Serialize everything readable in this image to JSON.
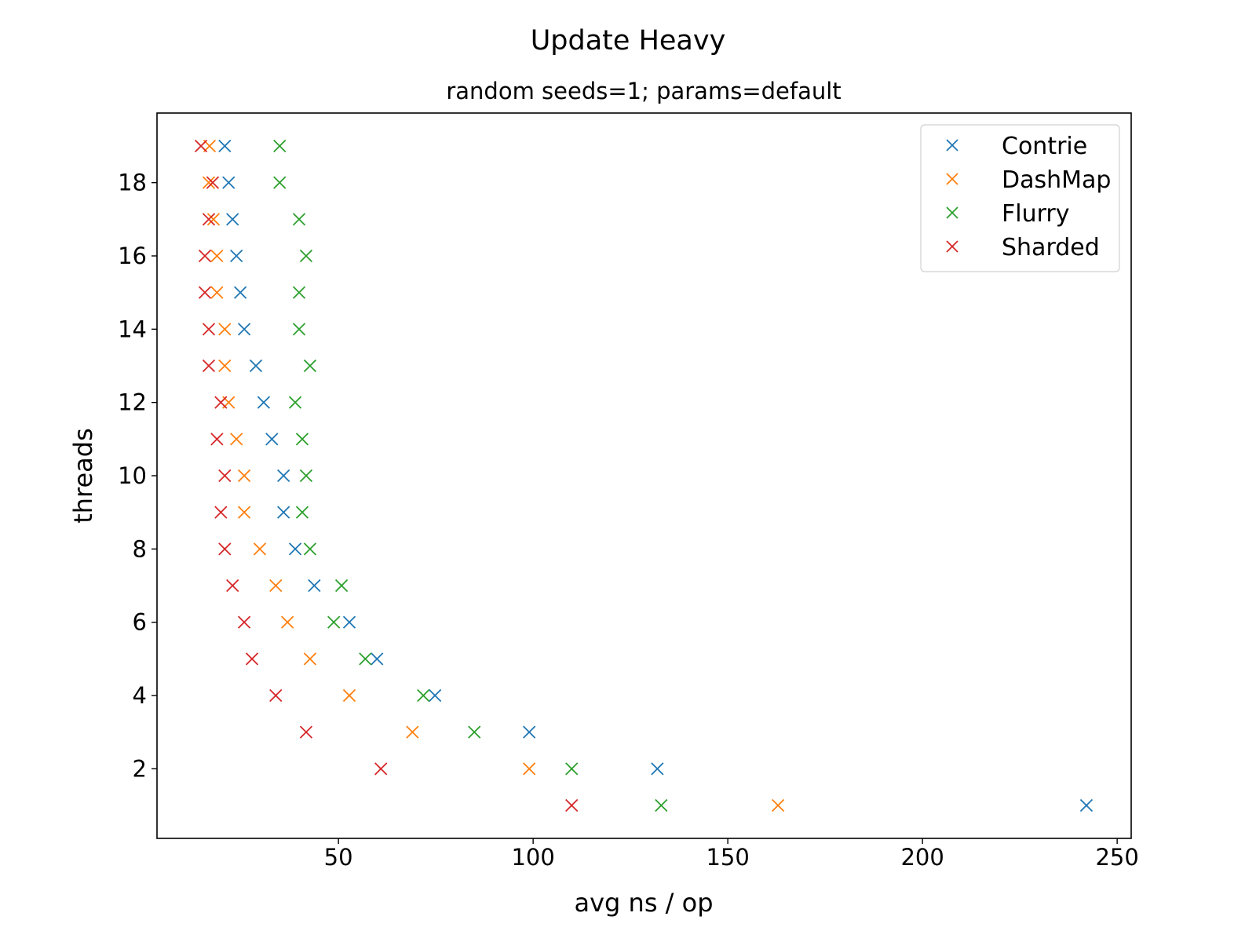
{
  "chart_data": {
    "type": "scatter",
    "title": "Update Heavy",
    "subtitle": "random seeds=1; params=default",
    "xlabel": "avg ns / op",
    "ylabel": "threads",
    "xlim": [
      3.4,
      253.6
    ],
    "ylim": [
      0.1,
      19.9
    ],
    "xticks": [
      50,
      100,
      150,
      200,
      250
    ],
    "yticks": [
      2,
      4,
      6,
      8,
      10,
      12,
      14,
      16,
      18
    ],
    "grid": false,
    "legend_position": "top-right",
    "marker": "x",
    "series": [
      {
        "name": "Contrie",
        "color": "#1f77b4",
        "points": [
          [
            242.1,
            1
          ],
          [
            131.9,
            2
          ],
          [
            99.0,
            3
          ],
          [
            74.8,
            4
          ],
          [
            59.9,
            5
          ],
          [
            52.8,
            6
          ],
          [
            43.8,
            7
          ],
          [
            38.9,
            8
          ],
          [
            35.9,
            9
          ],
          [
            35.9,
            10
          ],
          [
            32.9,
            11
          ],
          [
            30.8,
            12
          ],
          [
            28.8,
            13
          ],
          [
            25.8,
            14
          ],
          [
            24.8,
            15
          ],
          [
            23.8,
            16
          ],
          [
            22.8,
            17
          ],
          [
            21.8,
            18
          ],
          [
            20.8,
            19
          ]
        ]
      },
      {
        "name": "DashMap",
        "color": "#ff7f0e",
        "points": [
          [
            162.9,
            1
          ],
          [
            99.0,
            2
          ],
          [
            69.0,
            3
          ],
          [
            52.8,
            4
          ],
          [
            42.7,
            5
          ],
          [
            36.9,
            6
          ],
          [
            33.9,
            7
          ],
          [
            29.8,
            8
          ],
          [
            25.8,
            9
          ],
          [
            25.8,
            10
          ],
          [
            23.8,
            11
          ],
          [
            21.8,
            12
          ],
          [
            20.8,
            13
          ],
          [
            20.8,
            14
          ],
          [
            18.8,
            15
          ],
          [
            18.8,
            16
          ],
          [
            17.9,
            17
          ],
          [
            16.7,
            18
          ],
          [
            16.9,
            19
          ]
        ]
      },
      {
        "name": "Flurry",
        "color": "#2ca02c",
        "points": [
          [
            132.9,
            1
          ],
          [
            109.9,
            2
          ],
          [
            84.9,
            3
          ],
          [
            71.8,
            4
          ],
          [
            56.9,
            5
          ],
          [
            48.8,
            6
          ],
          [
            50.8,
            7
          ],
          [
            42.7,
            8
          ],
          [
            40.7,
            9
          ],
          [
            41.7,
            10
          ],
          [
            40.7,
            11
          ],
          [
            38.9,
            12
          ],
          [
            42.7,
            13
          ],
          [
            39.9,
            14
          ],
          [
            39.9,
            15
          ],
          [
            41.7,
            16
          ],
          [
            39.9,
            17
          ],
          [
            34.9,
            18
          ],
          [
            34.9,
            19
          ]
        ]
      },
      {
        "name": "Sharded",
        "color": "#d62728",
        "points": [
          [
            109.9,
            1
          ],
          [
            60.9,
            2
          ],
          [
            41.7,
            3
          ],
          [
            33.9,
            4
          ],
          [
            27.8,
            5
          ],
          [
            25.8,
            6
          ],
          [
            22.8,
            7
          ],
          [
            20.8,
            8
          ],
          [
            19.8,
            9
          ],
          [
            20.8,
            10
          ],
          [
            18.8,
            11
          ],
          [
            19.8,
            12
          ],
          [
            16.7,
            13
          ],
          [
            16.7,
            14
          ],
          [
            15.7,
            15
          ],
          [
            15.7,
            16
          ],
          [
            16.7,
            17
          ],
          [
            17.7,
            18
          ],
          [
            14.7,
            19
          ]
        ]
      }
    ]
  }
}
